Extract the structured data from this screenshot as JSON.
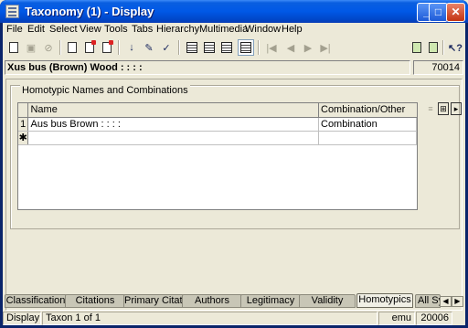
{
  "window": {
    "title": "Taxonomy (1) - Display"
  },
  "menu": [
    "File",
    "Edit",
    "Select",
    "View",
    "Tools",
    "Tabs",
    "Hierarchy",
    "Multimedia",
    "Window",
    "Help"
  ],
  "header": {
    "taxon_name": "Xus bus (Brown) Wood : : : :",
    "irn": "70014"
  },
  "section": {
    "label": "Homotypic Names and Combinations"
  },
  "grid": {
    "columns": [
      "Name",
      "Combination/Other"
    ],
    "rows": [
      {
        "num": "1",
        "name": "Aus bus Brown : : : :",
        "combination": "Combination"
      }
    ],
    "new_row_marker": "✱"
  },
  "tabs": [
    "Classification",
    "Citations",
    "Primary Citation",
    "Authors",
    "Legitimacy",
    "Validity",
    "Homotypics",
    "All Sy"
  ],
  "active_tab": "Homotypics",
  "status": {
    "mode": "Display",
    "position": "Taxon 1 of 1",
    "user": "emu",
    "count": "20006"
  }
}
